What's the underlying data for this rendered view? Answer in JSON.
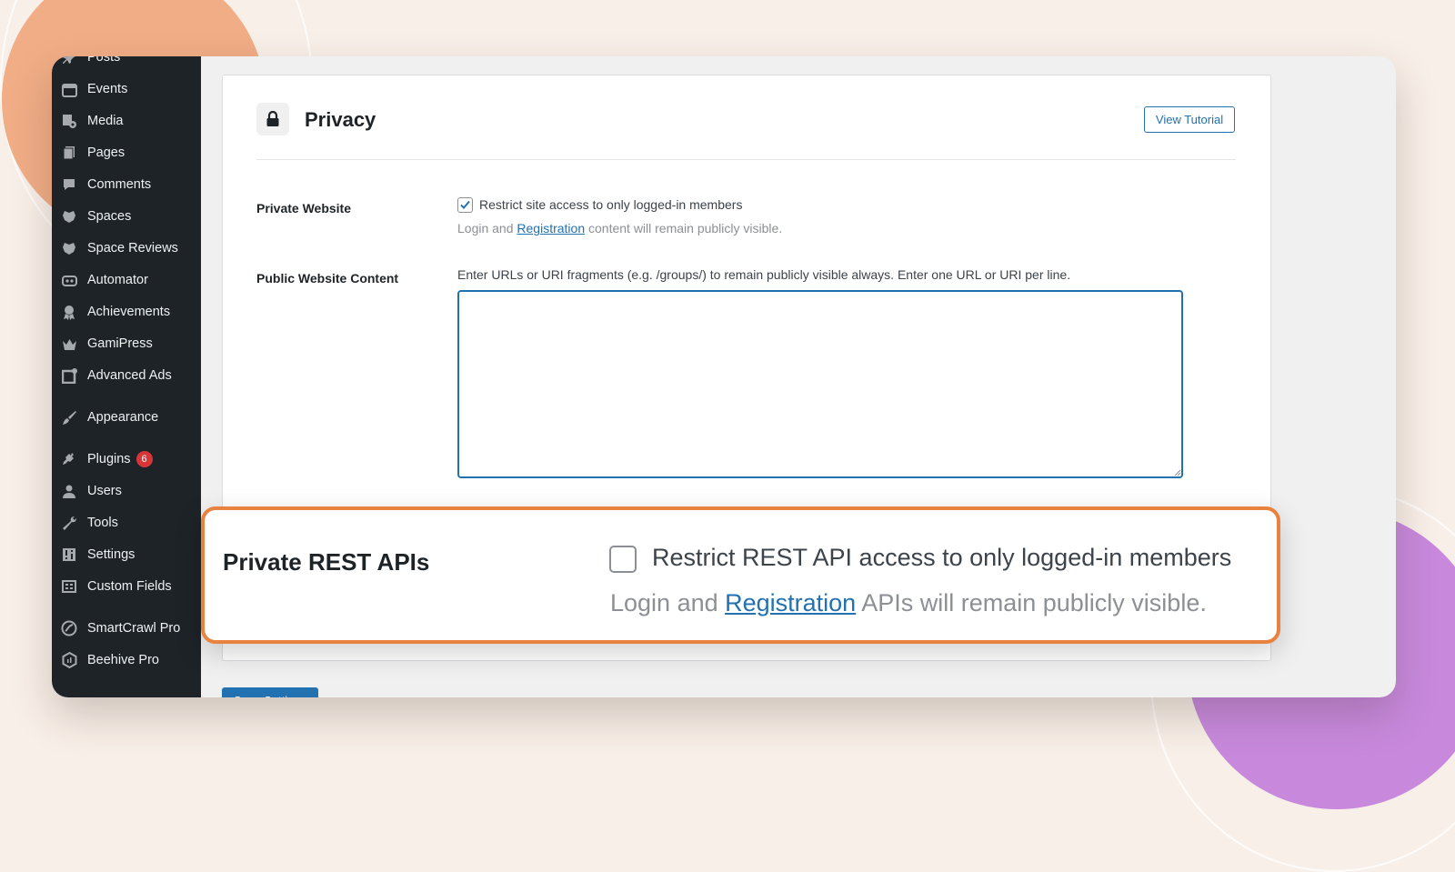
{
  "sidebar": {
    "items": [
      {
        "label": "Posts",
        "icon": "pin-icon"
      },
      {
        "label": "Events",
        "icon": "calendar-icon"
      },
      {
        "label": "Media",
        "icon": "media-icon"
      },
      {
        "label": "Pages",
        "icon": "pages-icon"
      },
      {
        "label": "Comments",
        "icon": "comment-icon"
      },
      {
        "label": "Spaces",
        "icon": "spaces-icon"
      },
      {
        "label": "Space Reviews",
        "icon": "spaces-icon"
      },
      {
        "label": "Automator",
        "icon": "robot-icon"
      },
      {
        "label": "Achievements",
        "icon": "award-icon"
      },
      {
        "label": "GamiPress",
        "icon": "crown-icon"
      },
      {
        "label": "Advanced Ads",
        "icon": "ads-icon"
      },
      {
        "label": "Appearance",
        "icon": "brush-icon"
      },
      {
        "label": "Plugins",
        "icon": "plug-icon",
        "badge": "6"
      },
      {
        "label": "Users",
        "icon": "user-icon"
      },
      {
        "label": "Tools",
        "icon": "wrench-icon"
      },
      {
        "label": "Settings",
        "icon": "sliders-icon"
      },
      {
        "label": "Custom Fields",
        "icon": "grid-icon"
      },
      {
        "label": "SmartCrawl Pro",
        "icon": "crawl-icon"
      },
      {
        "label": "Beehive Pro",
        "icon": "hexagon-icon"
      }
    ]
  },
  "panel": {
    "title": "Privacy",
    "tutorial_button": "View Tutorial",
    "private_website": {
      "label": "Private Website",
      "checkbox_label": "Restrict site access to only logged-in members",
      "checked": true,
      "help_prefix": "Login and ",
      "help_link": "Registration",
      "help_suffix": " content will remain publicly visible."
    },
    "public_content": {
      "label": "Public Website Content",
      "description": "Enter URLs or URI fragments (e.g. /groups/) to remain publicly visible always. Enter one URL or URI per line.",
      "value": ""
    }
  },
  "save_button": "Save Settings",
  "zoom": {
    "label": "Private REST APIs",
    "checkbox_label": "Restrict REST API access to only logged-in members",
    "checked": false,
    "help_prefix": "Login and ",
    "help_link": "Registration",
    "help_suffix": " APIs will remain publicly visible."
  },
  "colors": {
    "accent": "#2271b1",
    "highlight": "#e8823f",
    "sidebar_bg": "#1d2327",
    "badge": "#d63638"
  }
}
